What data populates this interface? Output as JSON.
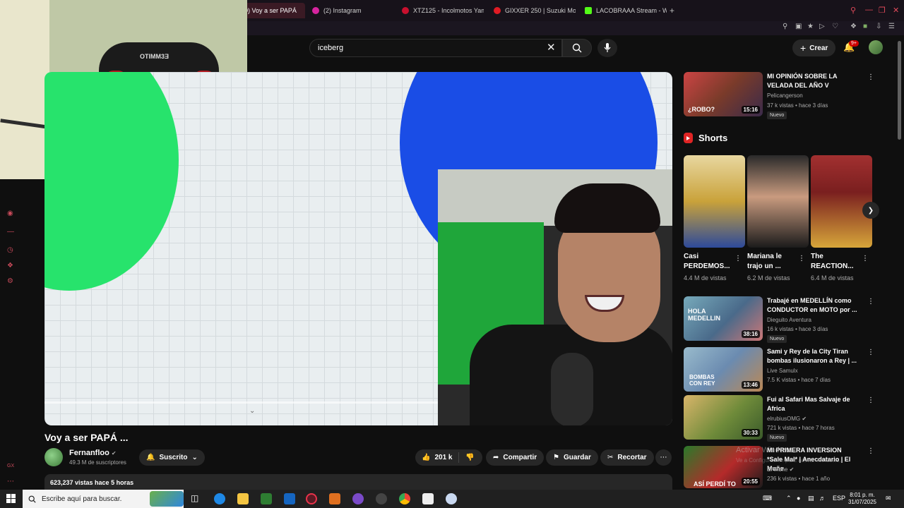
{
  "browser": {
    "tabs": [
      {
        "label": "0) Voy a ser PAPÁ",
        "active": true,
        "color": "#e8324a"
      },
      {
        "label": "(2) Instagram",
        "active": false,
        "color": "#d6249f"
      },
      {
        "label": "XTZ125 - Incolmotos Yam",
        "active": false,
        "color": "#c8102e"
      },
      {
        "label": "GIXXER 250 | Suzuki Mot",
        "active": false,
        "color": "#e01b24"
      },
      {
        "label": "LACOBRAAA Stream - Wa",
        "active": false,
        "color": "#53fc18"
      }
    ],
    "new_tab": "+"
  },
  "header": {
    "search_value": "iceberg",
    "create_label": "Crear",
    "notifications": "9+"
  },
  "video": {
    "title": "Voy a ser PAPÁ ...",
    "channel": "Fernanfloo",
    "subscribers": "49.3 M de suscriptores",
    "subscribed_label": "Suscrito",
    "likes": "201 k",
    "share_label": "Compartir",
    "save_label": "Guardar",
    "clip_label": "Recortar",
    "views_time": "623,237 vistas  hace 5 horas"
  },
  "recommendations": [
    {
      "title": "MI OPINIÓN SOBRE LA VELADA DEL AÑO V",
      "channel": "Pelicangerson",
      "meta": "37 k vistas • hace 3 días",
      "duration": "15:16",
      "badge": "Nuevo",
      "thumb": "#7a3b2a",
      "verified": false,
      "overlay": "¿ROBO?"
    },
    {
      "title": "Trabajé en MEDELLÍN como CONDUCTOR en MOTO por ...",
      "channel": "Dieguito Aventura",
      "meta": "16 k vistas • hace 3 días",
      "duration": "38:16",
      "badge": "Nuevo",
      "thumb": "#4a6a8a",
      "verified": false,
      "overlay": "HOLA MEDELLIN"
    },
    {
      "title": "Sami y Rey de la City Tiran bombas ilusionaron a Rey | ...",
      "channel": "Live Samulx",
      "meta": "7.5 K vistas • hace 7 días",
      "duration": "13:46",
      "badge": "",
      "thumb": "#6b8bb0",
      "verified": false,
      "overlay": "BOMBAS CON REY"
    },
    {
      "title": "Fui al Safari Mas Salvaje de Africa",
      "channel": "elrubiusOMG",
      "meta": "721 k vistas • hace 7 horas",
      "duration": "30:33",
      "badge": "Nuevo",
      "thumb": "#6f8b3a",
      "verified": true,
      "overlay": ""
    },
    {
      "title": "MI PRIMERA INVERSION *Sale Mal* | Anecdatario | El Muñe",
      "channel": "El Muñe",
      "meta": "236 k vistas • hace 1 año",
      "duration": "20:55",
      "badge": "",
      "thumb": "#b52a2a",
      "verified": true,
      "overlay": "ASÍ PERDÍ TO"
    }
  ],
  "shorts": {
    "heading": "Shorts",
    "items": [
      {
        "title": "Casi PERDEMOS...",
        "views": "4.4 M de vistas",
        "thumb": "#b89a3a"
      },
      {
        "title": "Mariana le trajo un ...",
        "views": "6.2 M de vistas",
        "thumb": "#3a3a3a"
      },
      {
        "title": "The REACTION...",
        "views": "6.4 M de vistas",
        "thumb": "#a23030"
      }
    ]
  },
  "windows_watermark": {
    "line1": "Activar Windows",
    "line2": "Ve a Configuración para activar Windows."
  },
  "taskbar": {
    "search_placeholder": "Escribe aquí para buscar.",
    "language": "ESP",
    "time": "8:01 p. m.",
    "date": "31/07/2025"
  },
  "webcam": {
    "chair_logo": "OTIMM3Ǝ"
  }
}
